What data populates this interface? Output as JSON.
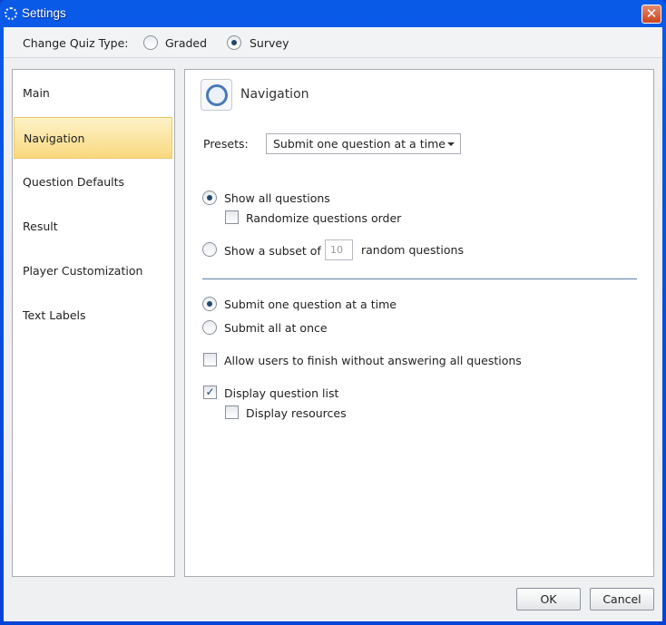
{
  "window": {
    "title": "Settings",
    "close_label": "✕"
  },
  "quiz_type": {
    "label": "Change Quiz Type:",
    "options": [
      "Graded",
      "Survey"
    ],
    "selected": "Survey"
  },
  "sidebar": {
    "items": [
      {
        "label": "Main"
      },
      {
        "label": "Navigation",
        "selected": true
      },
      {
        "label": "Question Defaults"
      },
      {
        "label": "Result"
      },
      {
        "label": "Player Customization"
      },
      {
        "label": "Text Labels"
      }
    ]
  },
  "panel": {
    "title": "Navigation",
    "presets_label": "Presets:",
    "presets_value": "Submit one question at a time",
    "show_all": "Show all questions",
    "randomize": "Randomize questions order",
    "subset_prefix": "Show a subset of",
    "subset_value": "10",
    "subset_suffix": "random questions",
    "submit_one": "Submit one question at a time",
    "submit_all": "Submit all at once",
    "allow_finish": "Allow users to finish without answering all questions",
    "display_list": "Display question list",
    "display_resources": "Display resources",
    "checkmark": "✓"
  },
  "footer": {
    "ok": "OK",
    "cancel": "Cancel"
  }
}
